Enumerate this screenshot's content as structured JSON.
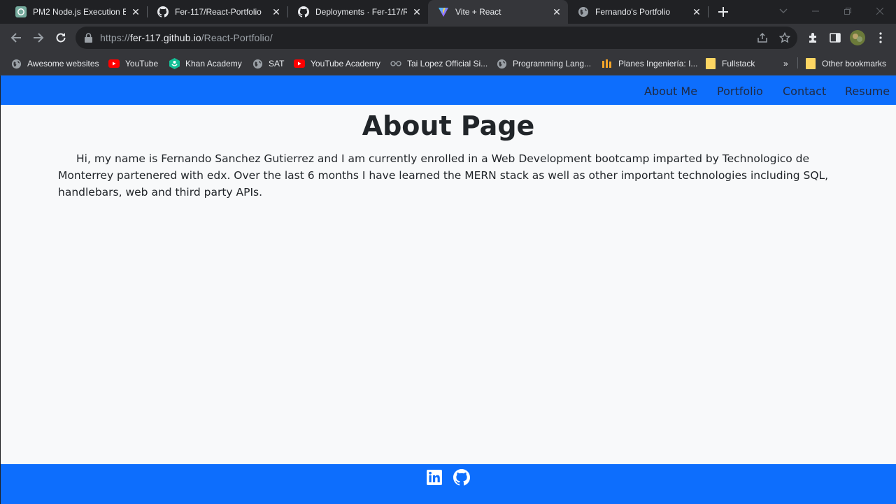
{
  "browser": {
    "tabs": [
      {
        "title": "PM2 Node.js Execution En",
        "icon": "chatgpt-icon"
      },
      {
        "title": "Fer-117/React-Portfolio",
        "icon": "github-icon"
      },
      {
        "title": "Deployments · Fer-117/Re",
        "icon": "github-icon"
      },
      {
        "title": "Vite + React",
        "icon": "vite-icon",
        "active": true
      },
      {
        "title": "Fernando's Portfolio",
        "icon": "globe-icon"
      }
    ],
    "address": {
      "scheme": "https://",
      "host": "fer-117.github.io",
      "path": "/React-Portfolio/"
    },
    "bookmarks": [
      {
        "label": "Awesome websites",
        "icon": "globe-icon"
      },
      {
        "label": "YouTube",
        "icon": "youtube-icon"
      },
      {
        "label": "Khan Academy",
        "icon": "khan-academy-icon"
      },
      {
        "label": "SAT",
        "icon": "globe-icon"
      },
      {
        "label": "YouTube Academy",
        "icon": "youtube-icon"
      },
      {
        "label": "Tai Lopez Official Si...",
        "icon": "glasses-icon"
      },
      {
        "label": "Programming Lang...",
        "icon": "globe-icon"
      },
      {
        "label": "Planes Ingeniería: I...",
        "icon": "planes-icon"
      },
      {
        "label": "Fullstack",
        "icon": "folder-icon"
      }
    ],
    "bookmarks_overflow": "»",
    "other_bookmarks": "Other bookmarks"
  },
  "navbar": {
    "links": [
      "About Me",
      "Portfolio",
      "Contact",
      "Resume"
    ]
  },
  "main": {
    "title": "About Page",
    "paragraph": "Hi, my name is Fernando Sanchez Gutierrez and I am currently enrolled in a Web Development bootcamp imparted by Technologico de Monterrey partenered with edx. Over the last 6 months I have learned the MERN stack as well as other important technologies including SQL, handlebars, web and third party APIs."
  },
  "footer": {
    "icons": [
      "linkedin-icon",
      "github-icon"
    ]
  },
  "colors": {
    "brand_blue": "#0d6efd",
    "page_bg": "#f8f9fa",
    "text_dark": "#212529",
    "browser_frame": "#202124",
    "browser_toolbar": "#35363a"
  }
}
